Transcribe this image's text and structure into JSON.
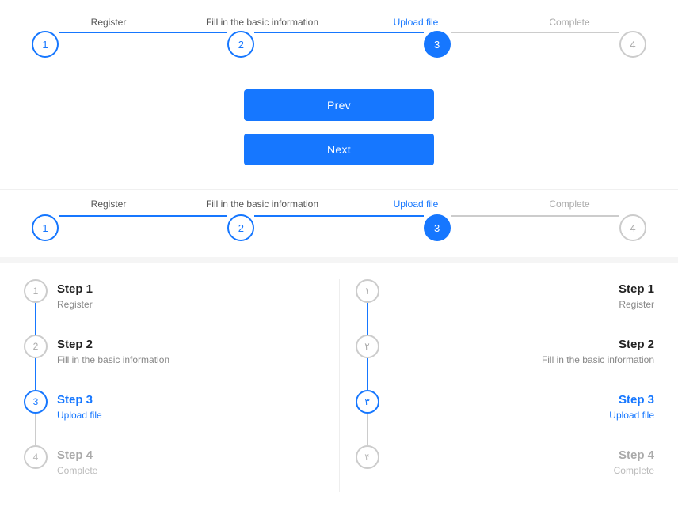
{
  "stepper1": {
    "labels": [
      "Register",
      "Fill in the basic information",
      "Upload file",
      "Complete"
    ],
    "states": [
      "completed",
      "completed",
      "active",
      "inactive"
    ],
    "steps": [
      "1",
      "2",
      "3",
      "4"
    ],
    "lines": [
      "completed",
      "completed",
      "inactive"
    ]
  },
  "buttons": {
    "prev_label": "Prev",
    "next_label": "Next"
  },
  "stepper2": {
    "labels": [
      "Register",
      "Fill in the basic information",
      "Upload file",
      "Complete"
    ],
    "states": [
      "completed",
      "completed",
      "active",
      "inactive"
    ],
    "steps": [
      "1",
      "2",
      "3",
      "4"
    ],
    "lines": [
      "completed",
      "completed",
      "inactive"
    ]
  },
  "stepper_left": {
    "steps": [
      {
        "num": "1",
        "title": "Step 1",
        "subtitle": "Register",
        "state": "completed"
      },
      {
        "num": "2",
        "title": "Step 2",
        "subtitle": "Fill in the basic information",
        "state": "completed"
      },
      {
        "num": "3",
        "title": "Step 3",
        "subtitle": "Upload file",
        "state": "active"
      },
      {
        "num": "4",
        "title": "Step 4",
        "subtitle": "Complete",
        "state": "inactive"
      }
    ]
  },
  "stepper_right": {
    "steps": [
      {
        "num": "١",
        "title": "Step 1",
        "subtitle": "Register",
        "state": "completed"
      },
      {
        "num": "٢",
        "title": "Step 2",
        "subtitle": "Fill in the basic information",
        "state": "completed"
      },
      {
        "num": "٣",
        "title": "Step 3",
        "subtitle": "Upload file",
        "state": "active"
      },
      {
        "num": "۴",
        "title": "Step 4",
        "subtitle": "Complete",
        "state": "inactive"
      }
    ]
  },
  "colors": {
    "active": "#1677ff",
    "completed_line": "#1677ff",
    "inactive": "#cccccc",
    "inactive_text": "#aaaaaa"
  }
}
